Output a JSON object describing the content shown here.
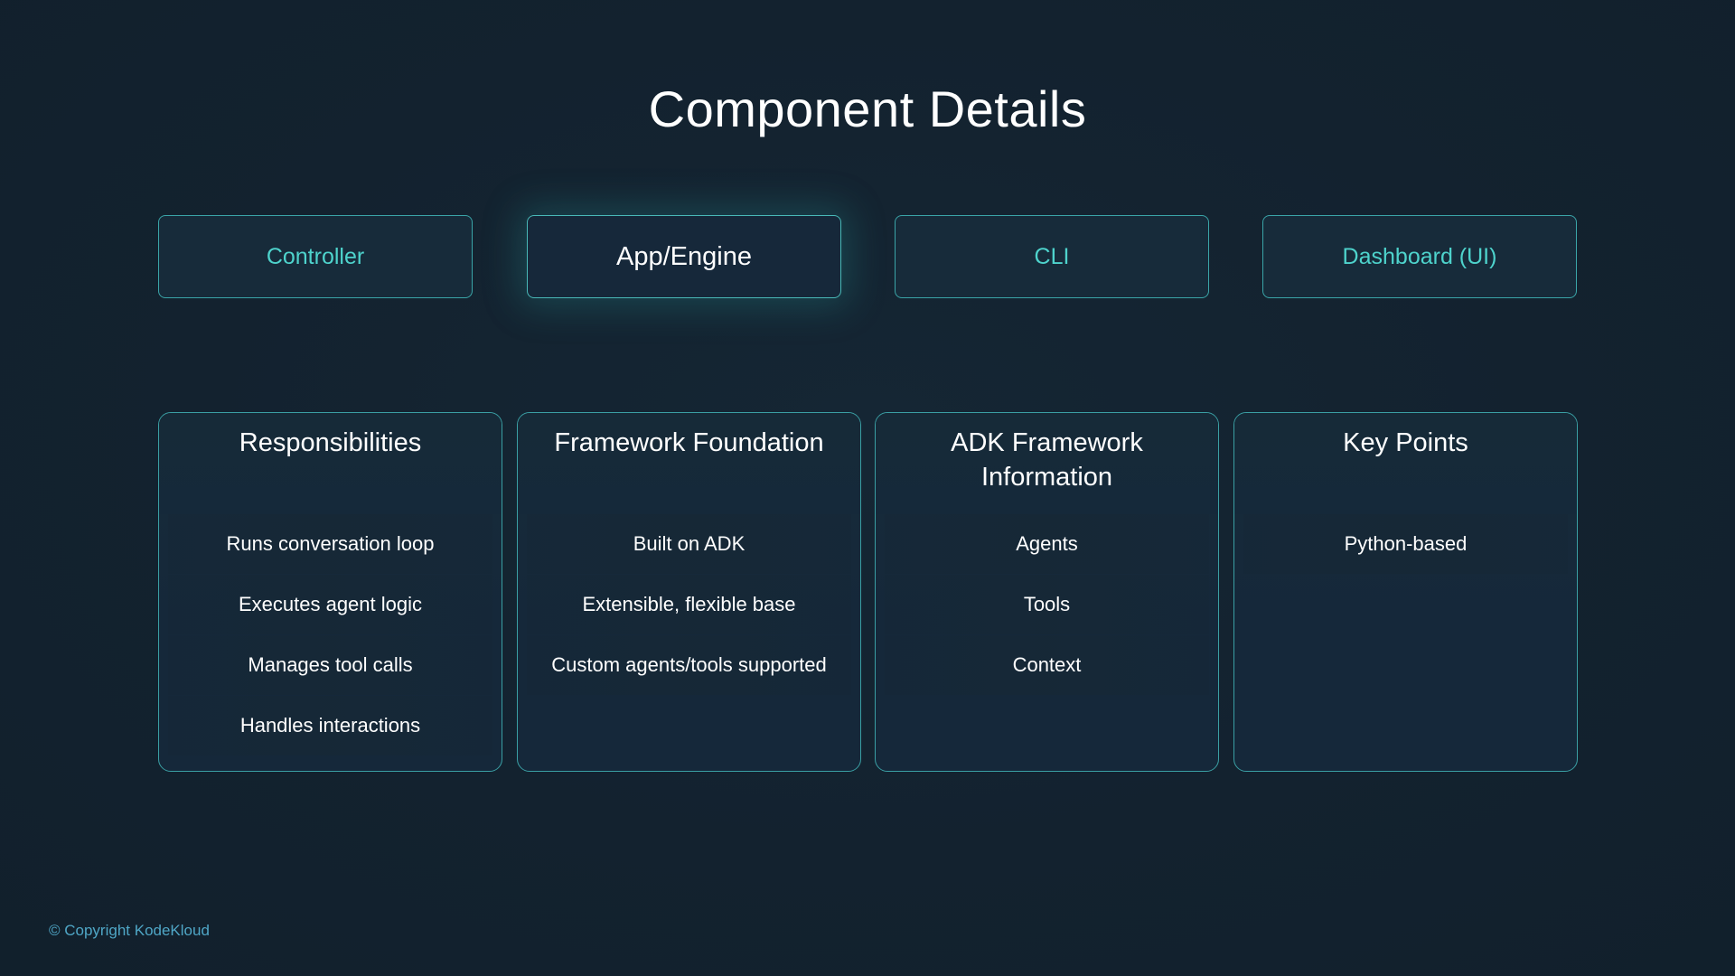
{
  "title": "Component Details",
  "tabs": [
    {
      "label": "Controller"
    },
    {
      "label": "App/Engine"
    },
    {
      "label": "CLI"
    },
    {
      "label": "Dashboard (UI)"
    }
  ],
  "active_tab": "App/Engine",
  "cards": [
    {
      "heading": "Responsibilities",
      "items": [
        "Runs conversation loop",
        "Executes agent logic",
        "Manages tool calls",
        "Handles interactions"
      ]
    },
    {
      "heading": "Framework Foundation",
      "items": [
        "Built on ADK",
        "Extensible, flexible base",
        "Custom agents/tools supported"
      ]
    },
    {
      "heading": "ADK Framework Information",
      "items": [
        "Agents",
        "Tools",
        "Context"
      ]
    },
    {
      "heading": "Key Points",
      "items": [
        "Python-based"
      ]
    }
  ],
  "footer": {
    "copyright": "© Copyright KodeKloud"
  },
  "colors": {
    "background": "#13222f",
    "accent": "#4ed3cc",
    "border": "#3aa5a8",
    "copyright": "#4fa6c6"
  }
}
